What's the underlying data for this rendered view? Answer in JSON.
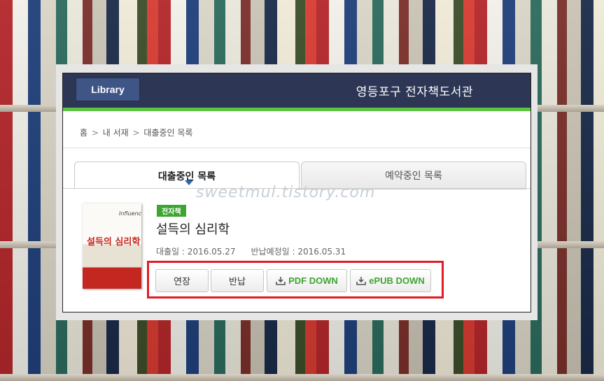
{
  "header": {
    "library_button": "Library",
    "site_title": "영등포구 전자책도서관"
  },
  "breadcrumb": {
    "items": [
      "홈",
      "내 서재",
      "대출중인 목록"
    ],
    "separator": ">"
  },
  "tabs": [
    {
      "label": "대출중인 목록",
      "active": true
    },
    {
      "label": "예약중인 목록",
      "active": false
    }
  ],
  "watermark": "sweetmul.tistory.com",
  "book": {
    "badge": "전자책",
    "title": "설득의 심리학",
    "cover_title": "설득의 심리학",
    "cover_tag": "Influence",
    "loan_date_label": "대출일 : 2016.05.27",
    "return_date_label": "반납예정일 : 2016.05.31"
  },
  "actions": {
    "extend": "연장",
    "return": "반납",
    "pdf_down": "PDF DOWN",
    "epub_down": "ePUB DOWN"
  },
  "colors": {
    "header_bg": "#2d3755",
    "accent_green": "#5cc442",
    "badge_green": "#3fa531",
    "highlight_red": "#e21b24"
  }
}
